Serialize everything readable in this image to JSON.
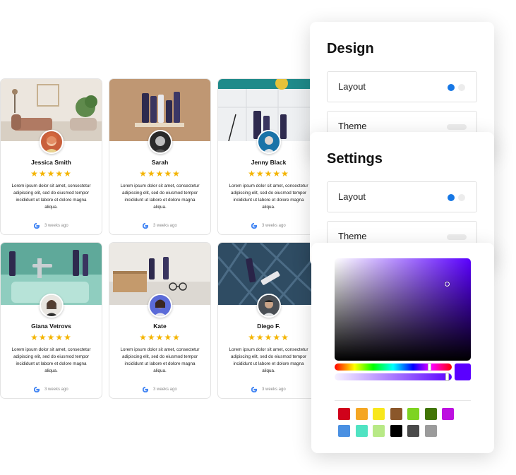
{
  "reviews": [
    {
      "name": "Jessica Smith",
      "stars": "★★★★★",
      "text": "Lorem ipsum dolor sit amet, consectetur adipiscing elit, sed do eiusmod tempor incididunt ut labore et dolore magna aliqua.",
      "time": "3 weeks ago"
    },
    {
      "name": "Sarah",
      "stars": "★★★★★",
      "text": "Lorem ipsum dolor sit amet, consectetur adipiscing elit, sed do eiusmod tempor incididunt ut labore et dolore magna aliqua.",
      "time": "3 weeks ago"
    },
    {
      "name": "Jenny Black",
      "stars": "★★★★★",
      "text": "Lorem ipsum dolor sit amet, consectetur adipiscing elit, sed do eiusmod tempor incididunt ut labore et dolore magna aliqua.",
      "time": "3 weeks ago"
    },
    {
      "name": "Giana Vetrovs",
      "stars": "★★★★★",
      "text": "Lorem ipsum dolor sit amet, consectetur adipiscing elit, sed do eiusmod tempor incididunt ut labore et dolore magna aliqua.",
      "time": "3 weeks ago"
    },
    {
      "name": "Kate",
      "stars": "★★★★★",
      "text": "Lorem ipsum dolor sit amet, consectetur adipiscing elit, sed do eiusmod tempor incididunt ut labore et dolore magna aliqua.",
      "time": "3 weeks ago"
    },
    {
      "name": "Diego F.",
      "stars": "★★★★★",
      "text": "Lorem ipsum dolor sit amet, consectetur adipiscing elit, sed do eiusmod tempor incididunt ut labore et dolore magna aliqua.",
      "time": "3 weeks ago"
    }
  ],
  "design_panel": {
    "title": "Design",
    "layout_label": "Layout",
    "theme_label": "Theme"
  },
  "settings_panel": {
    "title": "Settings",
    "layout_label": "Layout",
    "theme_label": "Theme"
  },
  "color_picker": {
    "selected_color": "#5a00ff",
    "hue_position": 0.8,
    "alpha": 0.97,
    "swatches": [
      "#d0021b",
      "#f5a623",
      "#f8e71c",
      "#8b572a",
      "#7ed321",
      "#417505",
      "#bd10e0",
      "#4a90e2",
      "#50e3c2",
      "#b8e986",
      "#000000",
      "#4a4a4a",
      "#9b9b9b"
    ]
  },
  "colors": {
    "star": "#f4b400",
    "accent": "#1677e5"
  }
}
